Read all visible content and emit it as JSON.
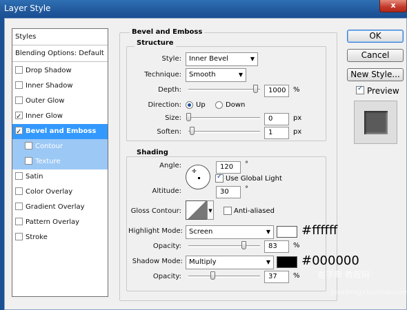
{
  "window": {
    "title": "Layer Style",
    "close": "x"
  },
  "styles_list": {
    "header": "Styles",
    "blending": "Blending Options: Default",
    "items": [
      {
        "label": "Drop Shadow",
        "checked": false
      },
      {
        "label": "Inner Shadow",
        "checked": false
      },
      {
        "label": "Outer Glow",
        "checked": false
      },
      {
        "label": "Inner Glow",
        "checked": true
      },
      {
        "label": "Bevel and Emboss",
        "checked": true
      },
      {
        "label": "Contour",
        "checked": false
      },
      {
        "label": "Texture",
        "checked": false
      },
      {
        "label": "Satin",
        "checked": false
      },
      {
        "label": "Color Overlay",
        "checked": false
      },
      {
        "label": "Gradient Overlay",
        "checked": false
      },
      {
        "label": "Pattern Overlay",
        "checked": false
      },
      {
        "label": "Stroke",
        "checked": false
      }
    ]
  },
  "bevel": {
    "section_title": "Bevel and Emboss",
    "structure": {
      "title": "Structure",
      "style_label": "Style:",
      "style_value": "Inner Bevel",
      "technique_label": "Technique:",
      "technique_value": "Smooth",
      "depth_label": "Depth:",
      "depth_value": "1000",
      "depth_unit": "%",
      "direction_label": "Direction:",
      "direction_up": "Up",
      "direction_down": "Down",
      "size_label": "Size:",
      "size_value": "0",
      "size_unit": "px",
      "soften_label": "Soften:",
      "soften_value": "1",
      "soften_unit": "px"
    },
    "shading": {
      "title": "Shading",
      "angle_label": "Angle:",
      "angle_value": "120",
      "angle_unit": "°",
      "global_light_label": "Use Global Light",
      "global_light_checked": true,
      "altitude_label": "Altitude:",
      "altitude_value": "30",
      "altitude_unit": "°",
      "gloss_label": "Gloss Contour:",
      "antialiased_label": "Anti-aliased",
      "highlight_mode_label": "Highlight Mode:",
      "highlight_mode_value": "Screen",
      "highlight_color": "#ffffff",
      "highlight_hex": "#ffffff",
      "highlight_opacity_label": "Opacity:",
      "highlight_opacity_value": "83",
      "highlight_opacity_unit": "%",
      "shadow_mode_label": "Shadow Mode:",
      "shadow_mode_value": "Multiply",
      "shadow_color": "#000000",
      "shadow_hex": "#000000",
      "shadow_opacity_label": "Opacity:",
      "shadow_opacity_value": "37",
      "shadow_opacity_unit": "%"
    }
  },
  "buttons": {
    "ok": "OK",
    "cancel": "Cancel",
    "new_style": "New Style...",
    "preview": "Preview"
  },
  "watermark": {
    "line1": "查字典 教程网",
    "line2": "jiaocheng.chazidian.com"
  }
}
